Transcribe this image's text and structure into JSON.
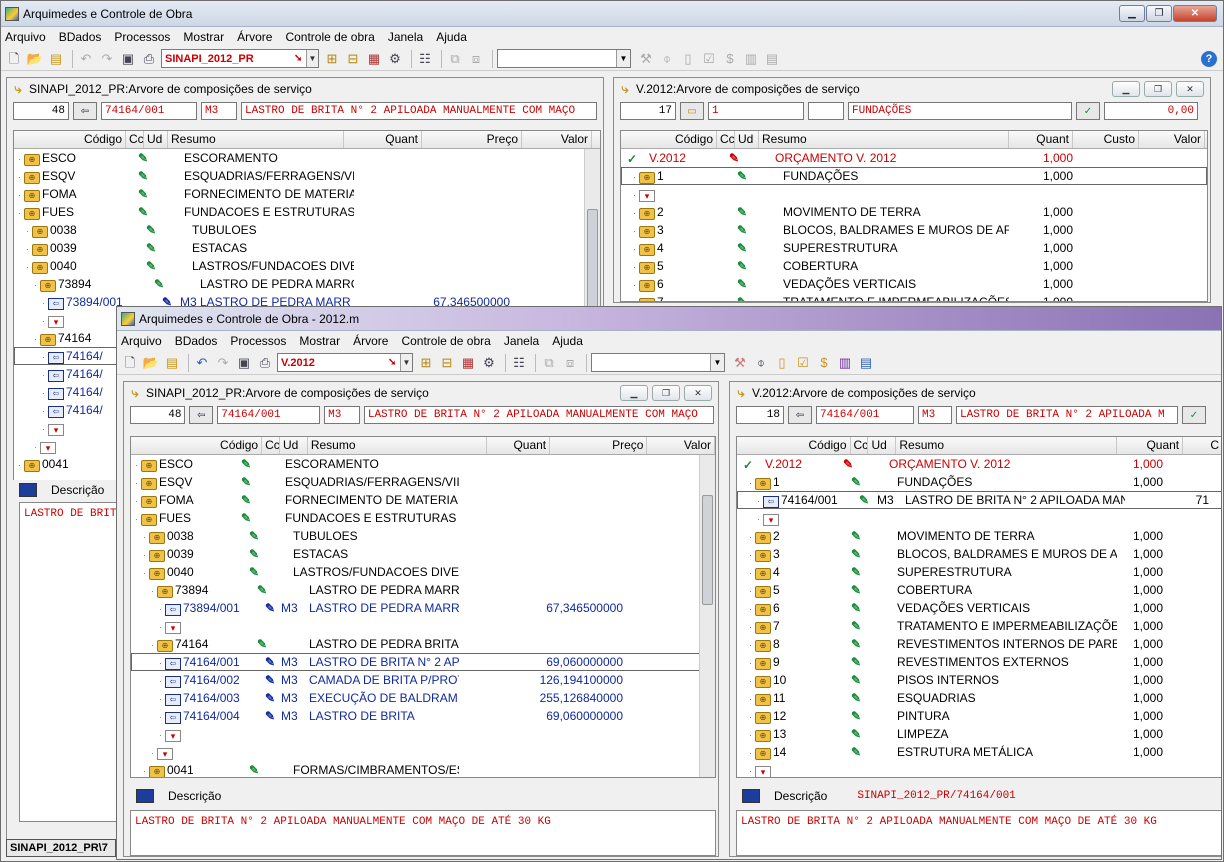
{
  "back": {
    "title": "Arquimedes e Controle de Obra",
    "menu": [
      "Arquivo",
      "BDados",
      "Processos",
      "Mostrar",
      "Árvore",
      "Controle de obra",
      "Janela",
      "Ajuda"
    ],
    "db": "SINAPI_2012_PR",
    "left": {
      "title": "SINAPI_2012_PR:Arvore de composições de serviço",
      "info": {
        "num": "48",
        "code": "74164/001",
        "unit": "M3",
        "text": "LASTRO DE BRITA N° 2 APILOADA MANUALMENTE COM MAÇO"
      },
      "headers": {
        "codigo": "Código",
        "cc": "Cc",
        "ud": "Ud",
        "resumo": "Resumo",
        "quant": "Quant",
        "preco": "Preço",
        "valor": "Valor"
      },
      "rows": [
        {
          "code": "ESCO",
          "ud": "",
          "res": "ESCORAMENTO",
          "q": ""
        },
        {
          "code": "ESQV",
          "ud": "",
          "res": "ESQUADRIAS/FERRAGENS/VII",
          "q": ""
        },
        {
          "code": "FOMA",
          "ud": "",
          "res": "FORNECIMENTO DE MATERIA",
          "q": ""
        },
        {
          "code": "FUES",
          "ud": "",
          "res": "FUNDACOES E ESTRUTURAS",
          "q": ""
        },
        {
          "code": "0038",
          "ud": "",
          "res": "TUBULOES",
          "q": ""
        },
        {
          "code": "0039",
          "ud": "",
          "res": "ESTACAS",
          "q": ""
        },
        {
          "code": "0040",
          "ud": "",
          "res": "LASTROS/FUNDACOES DIVE",
          "q": ""
        },
        {
          "code": "73894",
          "ud": "",
          "res": "LASTRO DE PEDRA MARRC",
          "q": ""
        },
        {
          "code": "73894/001",
          "ud": "M3",
          "res": "LASTRO DE PEDRA MARR",
          "q": "67,346500000"
        },
        {
          "code": "",
          "ud": "",
          "res": "",
          "q": ""
        },
        {
          "code": "74164",
          "ud": "",
          "res": "",
          "q": ""
        },
        {
          "code": "74164/",
          "ud": "",
          "res": "",
          "q": ""
        },
        {
          "code": "74164/",
          "ud": "",
          "res": "",
          "q": ""
        },
        {
          "code": "74164/",
          "ud": "",
          "res": "",
          "q": ""
        },
        {
          "code": "74164/",
          "ud": "",
          "res": "",
          "q": ""
        },
        {
          "code": "",
          "ud": "",
          "res": "",
          "q": ""
        },
        {
          "code": "",
          "ud": "",
          "res": "",
          "q": ""
        },
        {
          "code": "0041",
          "ud": "",
          "res": "",
          "q": ""
        }
      ],
      "desc_label": "Descrição",
      "desc_text": "LASTRO DE BRIT"
    },
    "right": {
      "title": "V.2012:Arvore de composições de serviço",
      "info": {
        "num": "17",
        "code": "1",
        "unit": "",
        "text": "FUNDAÇÕES",
        "valor": "0,00"
      },
      "headers": {
        "codigo": "Código",
        "cc": "Cc",
        "ud": "Ud",
        "resumo": "Resumo",
        "quant": "Quant",
        "custo": "Custo",
        "valor": "Valor"
      },
      "rows": [
        {
          "code": "V.2012",
          "res": "ORÇAMENTO V. 2012",
          "q": "1,000"
        },
        {
          "code": "1",
          "res": "FUNDAÇÕES",
          "q": "1,000"
        },
        {
          "code": "",
          "res": "",
          "q": ""
        },
        {
          "code": "2",
          "res": "MOVIMENTO DE TERRA",
          "q": "1,000"
        },
        {
          "code": "3",
          "res": "BLOCOS, BALDRAMES E MUROS DE AF",
          "q": "1,000"
        },
        {
          "code": "4",
          "res": "SUPERESTRUTURA",
          "q": "1,000"
        },
        {
          "code": "5",
          "res": "COBERTURA",
          "q": "1,000"
        },
        {
          "code": "6",
          "res": "VEDAÇÕES VERTICAIS",
          "q": "1,000"
        },
        {
          "code": "7",
          "res": "TRATAMENTO E IMPERMEABILIZAÇÕES",
          "q": "1,000"
        }
      ]
    },
    "taskbar": "SINAPI_2012_PR\\7"
  },
  "front": {
    "title": "Arquimedes e Controle de Obra - 2012.m",
    "menu": [
      "Arquivo",
      "BDados",
      "Processos",
      "Mostrar",
      "Árvore",
      "Controle de obra",
      "Janela",
      "Ajuda"
    ],
    "db": "V.2012",
    "left": {
      "title": "SINAPI_2012_PR:Arvore de composições de serviço",
      "info": {
        "num": "48",
        "code": "74164/001",
        "unit": "M3",
        "text": "LASTRO DE BRITA N° 2 APILOADA MANUALMENTE COM MAÇO"
      },
      "headers": {
        "codigo": "Código",
        "cc": "Cc",
        "ud": "Ud",
        "resumo": "Resumo",
        "quant": "Quant",
        "preco": "Preço",
        "valor": "Valor"
      },
      "rows": [
        {
          "code": "ESCO",
          "ud": "",
          "res": "ESCORAMENTO",
          "q": ""
        },
        {
          "code": "ESQV",
          "ud": "",
          "res": "ESQUADRIAS/FERRAGENS/VII",
          "q": ""
        },
        {
          "code": "FOMA",
          "ud": "",
          "res": "FORNECIMENTO DE MATERIA",
          "q": ""
        },
        {
          "code": "FUES",
          "ud": "",
          "res": "FUNDACOES E ESTRUTURAS",
          "q": ""
        },
        {
          "code": "0038",
          "ud": "",
          "res": "TUBULOES",
          "q": ""
        },
        {
          "code": "0039",
          "ud": "",
          "res": "ESTACAS",
          "q": ""
        },
        {
          "code": "0040",
          "ud": "",
          "res": "LASTROS/FUNDACOES DIVE",
          "q": ""
        },
        {
          "code": "73894",
          "ud": "",
          "res": "LASTRO DE PEDRA MARRC",
          "q": ""
        },
        {
          "code": "73894/001",
          "ud": "M3",
          "res": "LASTRO DE PEDRA MARR",
          "q": "67,346500000"
        },
        {
          "code": "",
          "ud": "",
          "res": "",
          "q": ""
        },
        {
          "code": "74164",
          "ud": "",
          "res": "LASTRO DE PEDRA BRITAD",
          "q": ""
        },
        {
          "code": "74164/001",
          "ud": "M3",
          "res": "LASTRO DE BRITA N° 2 AP",
          "q": "69,060000000"
        },
        {
          "code": "74164/002",
          "ud": "M3",
          "res": "CAMADA DE BRITA P/PROT",
          "q": "126,194100000"
        },
        {
          "code": "74164/003",
          "ud": "M3",
          "res": "EXECUÇÃO DE BALDRAM",
          "q": "255,126840000"
        },
        {
          "code": "74164/004",
          "ud": "M3",
          "res": "LASTRO DE BRITA",
          "q": "69,060000000"
        },
        {
          "code": "",
          "ud": "",
          "res": "",
          "q": ""
        },
        {
          "code": "",
          "ud": "",
          "res": "",
          "q": ""
        },
        {
          "code": "0041",
          "ud": "",
          "res": "FORMAS/CIMBRAMENTOS/ES",
          "q": ""
        }
      ],
      "desc_label": "Descrição",
      "desc_text": "LASTRO DE BRITA N° 2 APILOADA MANUALMENTE COM MAÇO DE ATÉ 30 KG"
    },
    "right": {
      "title": "V.2012:Arvore de composições de serviço",
      "info": {
        "num": "18",
        "code": "74164/001",
        "unit": "M3",
        "text": "LASTRO DE BRITA N° 2 APILOADA M"
      },
      "headers": {
        "codigo": "Código",
        "cc": "Cc",
        "ud": "Ud",
        "resumo": "Resumo",
        "quant": "Quant",
        "c": "C"
      },
      "rows": [
        {
          "code": "V.2012",
          "ud": "",
          "res": "ORÇAMENTO V. 2012",
          "q": "1,000",
          "x": ""
        },
        {
          "code": "1",
          "ud": "",
          "res": "FUNDAÇÕES",
          "q": "1,000",
          "x": ""
        },
        {
          "code": "74164/001",
          "ud": "M3",
          "res": "LASTRO DE BRITA N° 2 APILOADA MAN",
          "q": "",
          "x": "71"
        },
        {
          "code": "",
          "ud": "",
          "res": "",
          "q": "",
          "x": ""
        },
        {
          "code": "2",
          "ud": "",
          "res": "MOVIMENTO DE TERRA",
          "q": "1,000",
          "x": ""
        },
        {
          "code": "3",
          "ud": "",
          "res": "BLOCOS, BALDRAMES E MUROS DE AF",
          "q": "1,000",
          "x": ""
        },
        {
          "code": "4",
          "ud": "",
          "res": "SUPERESTRUTURA",
          "q": "1,000",
          "x": ""
        },
        {
          "code": "5",
          "ud": "",
          "res": "COBERTURA",
          "q": "1,000",
          "x": ""
        },
        {
          "code": "6",
          "ud": "",
          "res": "VEDAÇÕES VERTICAIS",
          "q": "1,000",
          "x": ""
        },
        {
          "code": "7",
          "ud": "",
          "res": "TRATAMENTO E IMPERMEABILIZAÇÕES",
          "q": "1,000",
          "x": ""
        },
        {
          "code": "8",
          "ud": "",
          "res": "REVESTIMENTOS INTERNOS DE PAREI",
          "q": "1,000",
          "x": ""
        },
        {
          "code": "9",
          "ud": "",
          "res": "REVESTIMENTOS EXTERNOS",
          "q": "1,000",
          "x": ""
        },
        {
          "code": "10",
          "ud": "",
          "res": "PISOS INTERNOS",
          "q": "1,000",
          "x": ""
        },
        {
          "code": "11",
          "ud": "",
          "res": "ESQUADRIAS",
          "q": "1,000",
          "x": ""
        },
        {
          "code": "12",
          "ud": "",
          "res": "PINTURA",
          "q": "1,000",
          "x": ""
        },
        {
          "code": "13",
          "ud": "",
          "res": "LIMPEZA",
          "q": "1,000",
          "x": ""
        },
        {
          "code": "14",
          "ud": "",
          "res": "ESTRUTURA METÁLICA",
          "q": "1,000",
          "x": ""
        },
        {
          "code": "",
          "ud": "",
          "res": "",
          "q": "",
          "x": ""
        }
      ],
      "desc_label": "Descrição",
      "desc_ref": "SINAPI_2012_PR/74164/001",
      "desc_text": "LASTRO DE BRITA N° 2 APILOADA MANUALMENTE COM MAÇO DE ATÉ 30 KG"
    }
  }
}
